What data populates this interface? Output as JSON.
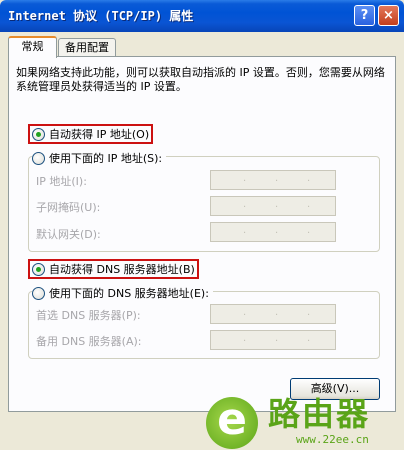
{
  "window": {
    "title": "Internet 协议 (TCP/IP) 属性",
    "help_glyph": "?",
    "close_glyph": "×"
  },
  "tabs": [
    {
      "label": "常规",
      "selected": true
    },
    {
      "label": "备用配置",
      "selected": false
    }
  ],
  "description": "如果网络支持此功能，则可以获取自动指派的 IP 设置。否则，您需要从网络系统管理员处获得适当的 IP 设置。",
  "ip_section": {
    "auto_label": "自动获得 IP 地址(O)",
    "auto_checked": true,
    "manual_label": "使用下面的 IP 地址(S):",
    "manual_checked": false,
    "fields": [
      {
        "label": "IP 地址(I):"
      },
      {
        "label": "子网掩码(U):"
      },
      {
        "label": "默认网关(D):"
      }
    ]
  },
  "dns_section": {
    "auto_label": "自动获得 DNS 服务器地址(B)",
    "auto_checked": true,
    "manual_label": "使用下面的 DNS 服务器地址(E):",
    "manual_checked": false,
    "fields": [
      {
        "label": "首选 DNS 服务器(P):"
      },
      {
        "label": "备用 DNS 服务器(A):"
      }
    ]
  },
  "advanced_button": "高级(V)...",
  "watermark": {
    "logo_letter": "e",
    "brand": "路由器",
    "url": "www.22ee.cn"
  },
  "colors": {
    "titlebar": "#0053d5",
    "highlight_box": "#cc1111",
    "watermark_green": "#5aa418"
  },
  "ip_dots": "."
}
